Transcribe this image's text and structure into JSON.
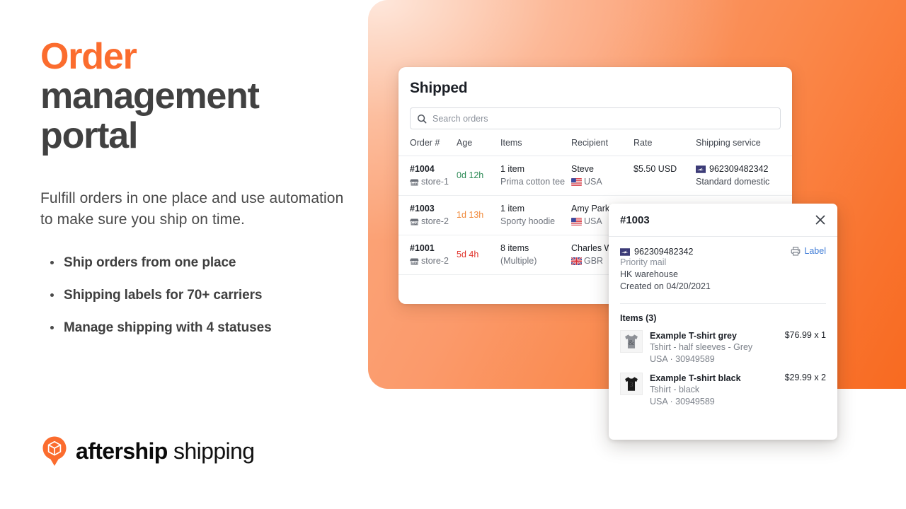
{
  "marketing": {
    "headline_accent": "Order",
    "headline_rest_1": "management",
    "headline_rest_2": "portal",
    "subhead": "Fulfill orders in one place and use automation to make sure you ship on time.",
    "bullets": [
      "Ship orders from one place",
      "Shipping labels for 70+ carriers",
      "Manage shipping with 4 statuses"
    ]
  },
  "logo": {
    "word_bold": "aftership",
    "word_light": "shipping",
    "mark_icon": "aftership-pin-box-icon",
    "accent_color": "#fb6c2e"
  },
  "orders_card": {
    "title": "Shipped",
    "search": {
      "icon": "search-icon",
      "placeholder": "Search orders",
      "value": ""
    },
    "columns": [
      "Order #",
      "Age",
      "Items",
      "Recipient",
      "Rate",
      "Shipping service"
    ],
    "rows": [
      {
        "order": "#1004",
        "store": "store-1",
        "store_icon": "storefront-icon",
        "age": "0d 12h",
        "age_level": "green",
        "items_count": "1 item",
        "items_detail": "Prima cotton tee",
        "recipient": "Steve",
        "country": "USA",
        "flag_icon": "flag-usa-icon",
        "rate": "$5.50 USD",
        "tracking": "962309482342",
        "carrier_icon": "usps-icon",
        "service": "Standard domestic"
      },
      {
        "order": "#1003",
        "store": "store-2",
        "store_icon": "storefront-icon",
        "age": "1d 13h",
        "age_level": "orange",
        "items_count": "1 item",
        "items_detail": "Sporty hoodie",
        "recipient": "Amy Parker",
        "country": "USA",
        "flag_icon": "flag-usa-icon",
        "rate": "",
        "tracking": "",
        "carrier_icon": "usps-icon",
        "service": ""
      },
      {
        "order": "#1001",
        "store": "store-2",
        "store_icon": "storefront-icon",
        "age": "5d 4h",
        "age_level": "red",
        "items_count": "8 items",
        "items_detail": "(Multiple)",
        "recipient": "Charles Wu",
        "country": "GBR",
        "flag_icon": "flag-gbr-icon",
        "rate": "",
        "tracking": "",
        "carrier_icon": "usps-icon",
        "service": ""
      }
    ]
  },
  "detail_panel": {
    "title": "#1003",
    "close_icon": "close-icon",
    "tracking_number": "962309482342",
    "carrier_icon": "usps-icon",
    "service": "Priority mail",
    "warehouse": "HK warehouse",
    "created": "Created on 04/20/2021",
    "label_button": {
      "label": "Label",
      "icon": "printer-icon",
      "color": "#3d7bd6"
    },
    "items_title": "Items (3)",
    "items": [
      {
        "thumb_icon": "tshirt-grey-icon",
        "name": "Example T-shirt grey",
        "desc": "Tshirt - half sleeves - Grey",
        "sku": "USA · 30949589",
        "price": "$76.99 x 1"
      },
      {
        "thumb_icon": "tshirt-black-icon",
        "name": "Example T-shirt black",
        "desc": "Tshirt - black",
        "sku": "USA · 30949589",
        "price": "$29.99 x  2"
      }
    ]
  }
}
